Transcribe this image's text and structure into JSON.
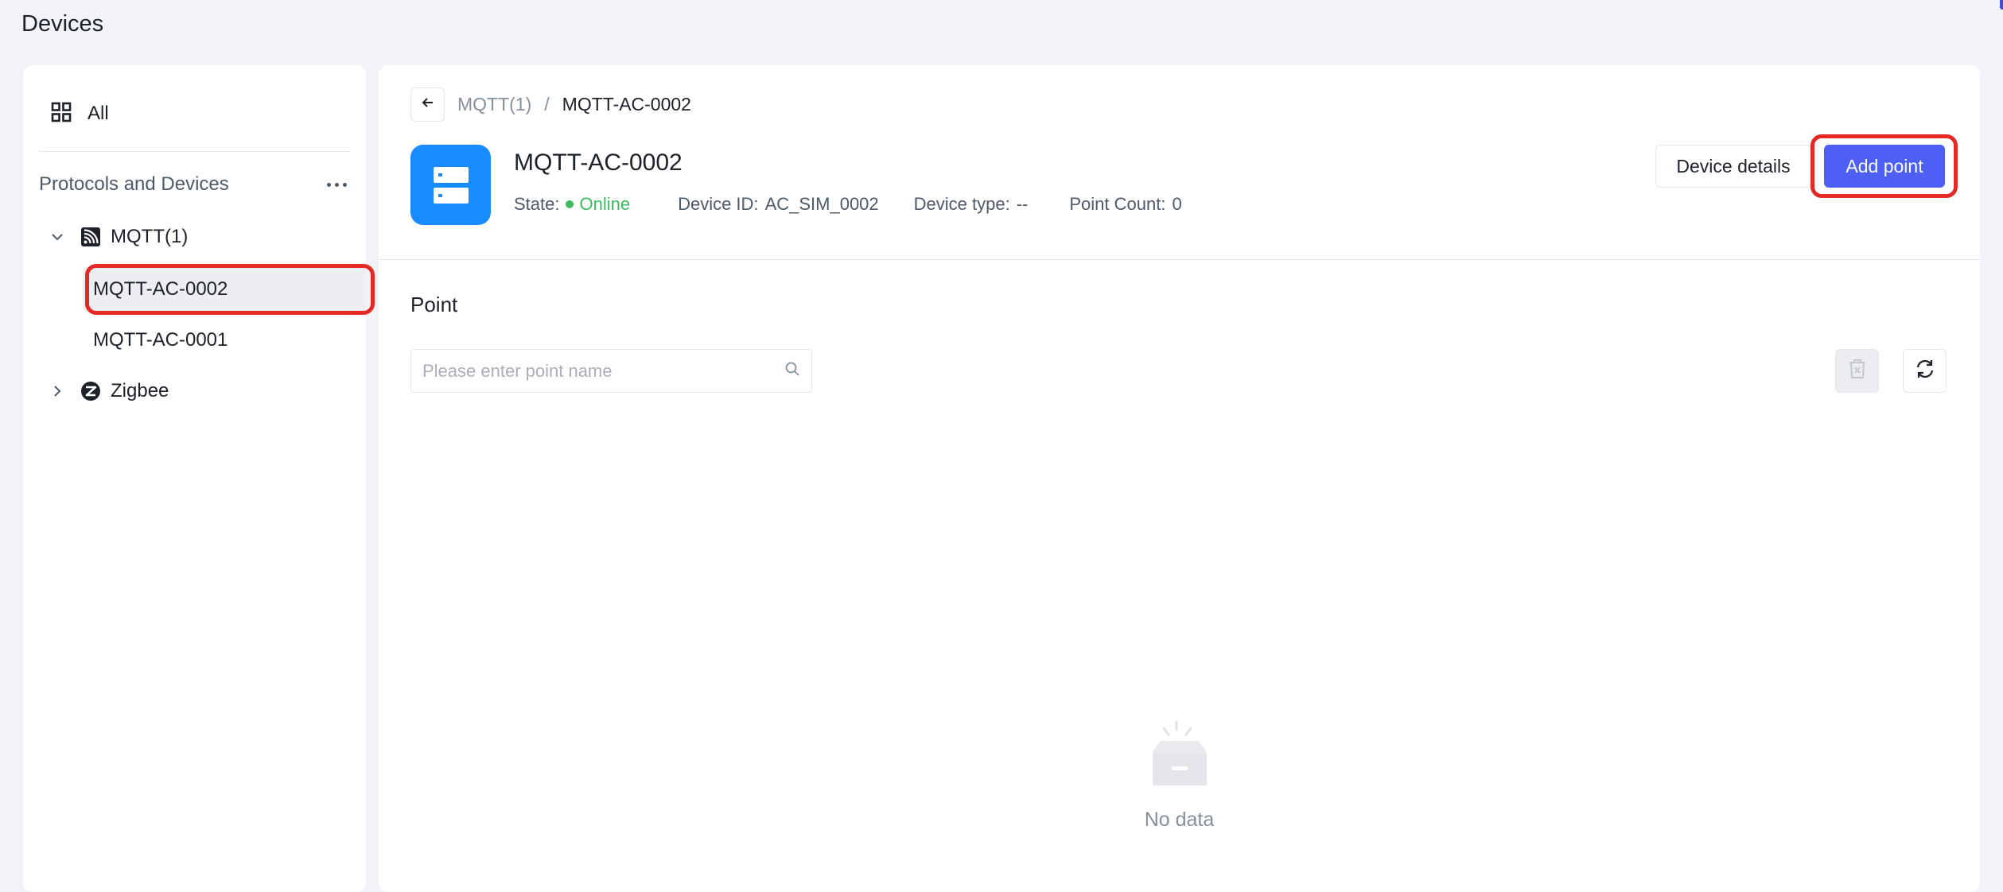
{
  "page": {
    "title": "Devices"
  },
  "sidebar": {
    "all_label": "All",
    "section_title": "Protocols and Devices",
    "protocols": [
      {
        "name": "MQTT(1)",
        "expanded": true,
        "devices": [
          {
            "name": "MQTT-AC-0002",
            "selected": true
          },
          {
            "name": "MQTT-AC-0001",
            "selected": false
          }
        ]
      },
      {
        "name": "Zigbee",
        "expanded": false
      }
    ]
  },
  "main": {
    "breadcrumb": {
      "parent": "MQTT(1)",
      "separator": "/",
      "current": "MQTT-AC-0002"
    },
    "device": {
      "name": "MQTT-AC-0002",
      "state_label": "State:",
      "state_value": "Online",
      "id_label": "Device ID:",
      "id_value": "AC_SIM_0002",
      "type_label": "Device type:",
      "type_value": "--",
      "count_label": "Point Count:",
      "count_value": "0"
    },
    "buttons": {
      "details": "Device details",
      "add_point": "Add point"
    },
    "section_title": "Point",
    "search": {
      "placeholder": "Please enter point name",
      "value": ""
    },
    "empty_text": "No data"
  },
  "colors": {
    "accent": "#4d5ff5",
    "device_icon_bg": "#168cff",
    "online": "#3cbb5f",
    "highlight": "#e52a26"
  },
  "icons": {
    "all": "grid-icon",
    "more": "more-horizontal-icon",
    "mqtt": "mqtt-signal-icon",
    "zigbee": "zigbee-icon",
    "back": "arrow-left-icon",
    "device": "server-icon",
    "search": "search-icon",
    "delete": "trash-icon",
    "refresh": "refresh-icon",
    "empty": "empty-box-icon"
  }
}
